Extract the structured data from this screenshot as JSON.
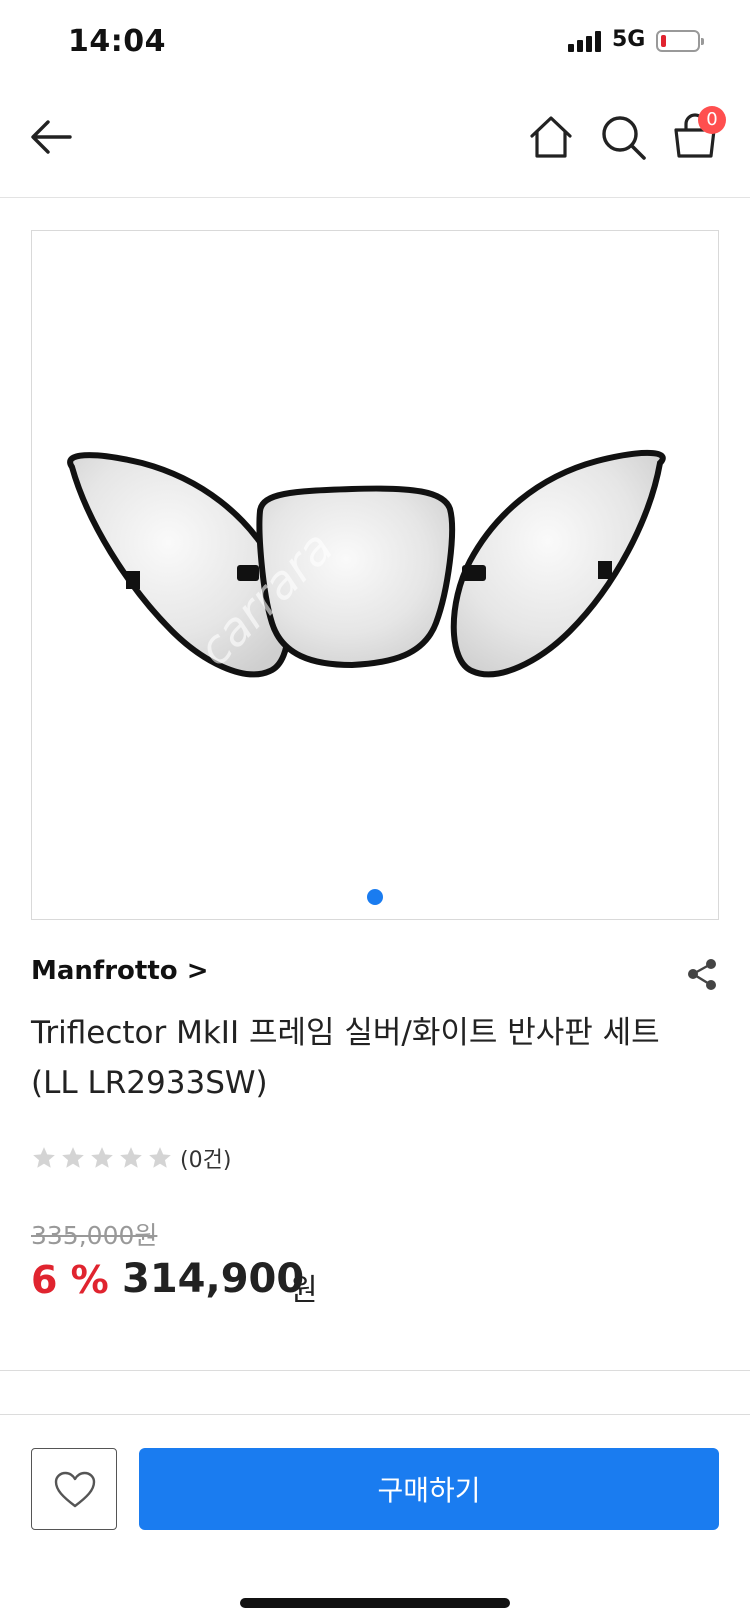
{
  "status_bar": {
    "time": "14:04",
    "network": "5G"
  },
  "header": {
    "cart_count": "0"
  },
  "gallery": {
    "watermark": "carrara"
  },
  "product": {
    "brand": "Manfrotto >",
    "title": "Triflector MkII 프레임 실버/화이트 반사판 세트 (LL LR2933SW)",
    "rating": 0,
    "review_count": "(0건)",
    "original_price": "335,000원",
    "discount": "6 %",
    "sale_price": "314,900",
    "price_unit": "원"
  },
  "bottom_bar": {
    "buy_label": "구매하기"
  },
  "colors": {
    "accent": "#1a7cf0",
    "sale": "#e0242f",
    "badge": "#ff4f4f"
  },
  "icons": [
    "arrow-left-icon",
    "home-icon",
    "search-icon",
    "cart-icon",
    "share-icon",
    "star-icon",
    "heart-icon"
  ]
}
